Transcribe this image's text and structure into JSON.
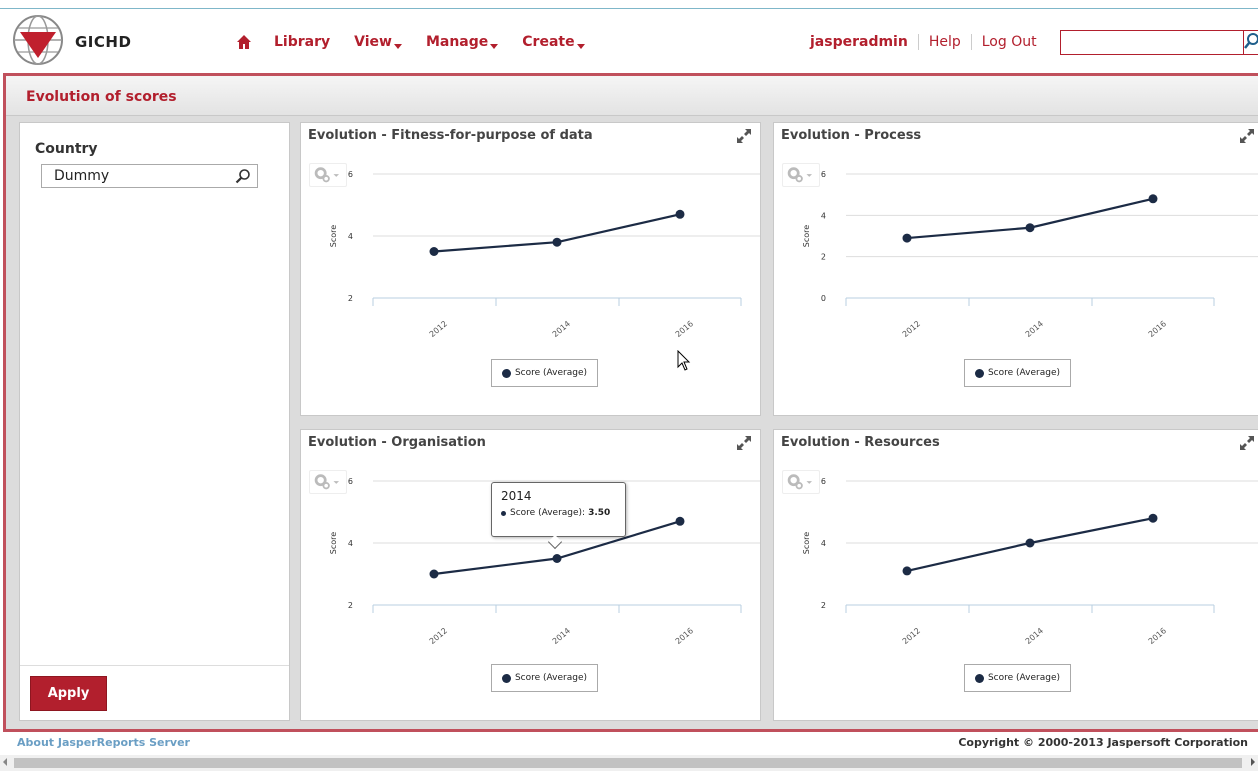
{
  "header": {
    "logo_text": "GICHD",
    "nav": [
      {
        "label": "Library",
        "dropdown": false
      },
      {
        "label": "View",
        "dropdown": true
      },
      {
        "label": "Manage",
        "dropdown": true
      },
      {
        "label": "Create",
        "dropdown": true
      }
    ],
    "user": "jasperadmin",
    "help": "Help",
    "logout": "Log Out",
    "search_value": ""
  },
  "page": {
    "title": "Evolution of scores"
  },
  "filters": {
    "country_label": "Country",
    "country_value": "Dummy",
    "apply_label": "Apply"
  },
  "chart_data": [
    {
      "type": "line",
      "title": "Evolution - Fitness-for-purpose of data",
      "ylabel": "Score",
      "categories": [
        "2012",
        "2014",
        "2016"
      ],
      "series": [
        {
          "name": "Score (Average)",
          "values": [
            3.5,
            3.8,
            4.7
          ]
        }
      ],
      "yticks": [
        2,
        4,
        6
      ],
      "ylim": [
        2,
        6
      ],
      "grid": true,
      "legend": "bottom"
    },
    {
      "type": "line",
      "title": "Evolution - Process",
      "ylabel": "Score",
      "categories": [
        "2012",
        "2014",
        "2016"
      ],
      "series": [
        {
          "name": "Score (Average)",
          "values": [
            2.9,
            3.4,
            4.8
          ]
        }
      ],
      "yticks": [
        0,
        2,
        4,
        6
      ],
      "ylim": [
        0,
        6
      ],
      "grid": true,
      "legend": "bottom"
    },
    {
      "type": "line",
      "title": "Evolution - Organisation",
      "ylabel": "Score",
      "categories": [
        "2012",
        "2014",
        "2016"
      ],
      "series": [
        {
          "name": "Score (Average)",
          "values": [
            3.0,
            3.5,
            4.7
          ]
        }
      ],
      "yticks": [
        2,
        4,
        6
      ],
      "ylim": [
        2,
        6
      ],
      "grid": true,
      "legend": "bottom"
    },
    {
      "type": "line",
      "title": "Evolution - Resources",
      "ylabel": "Score",
      "categories": [
        "2012",
        "2014",
        "2016"
      ],
      "series": [
        {
          "name": "Score (Average)",
          "values": [
            3.1,
            4.0,
            4.8
          ]
        }
      ],
      "yticks": [
        2,
        4,
        6
      ],
      "ylim": [
        2,
        6
      ],
      "grid": true,
      "legend": "bottom"
    }
  ],
  "tooltip": {
    "year": "2014",
    "series_label": "Score (Average):",
    "value": "3.50"
  },
  "footer": {
    "about": "About JasperReports Server",
    "copyright": "Copyright © 2000-2013 Jaspersoft Corporation"
  },
  "colors": {
    "brand": "#b21f2d",
    "series": "#1c2b45",
    "frame": "#c0505c"
  }
}
